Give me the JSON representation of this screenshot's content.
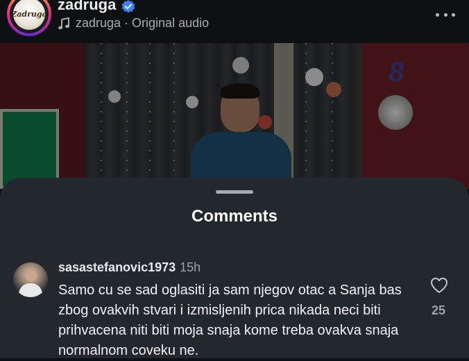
{
  "header": {
    "username": "zadruga",
    "avatar_text": "Zadruga",
    "audio_label": "zadruga · Original audio"
  },
  "sheet": {
    "title": "Comments"
  },
  "comments": [
    {
      "username": "sasastefanovic1973",
      "time": "15h",
      "text": "Samo cu se sad oglasiti ja sam njegov otac a Sanja bas zbog ovakvih stvari i izmisljenih prica nikada neci biti prihvacena niti biti moja snaja kome treba ovakva snaja normalnom coveku ne.",
      "likes": "25"
    }
  ],
  "colors": {
    "sheet_background": "#22282e",
    "verified_badge": "#3b82f6"
  },
  "icons": [
    "verified-badge-icon",
    "music-note-icon",
    "more-options-icon",
    "heart-icon"
  ]
}
